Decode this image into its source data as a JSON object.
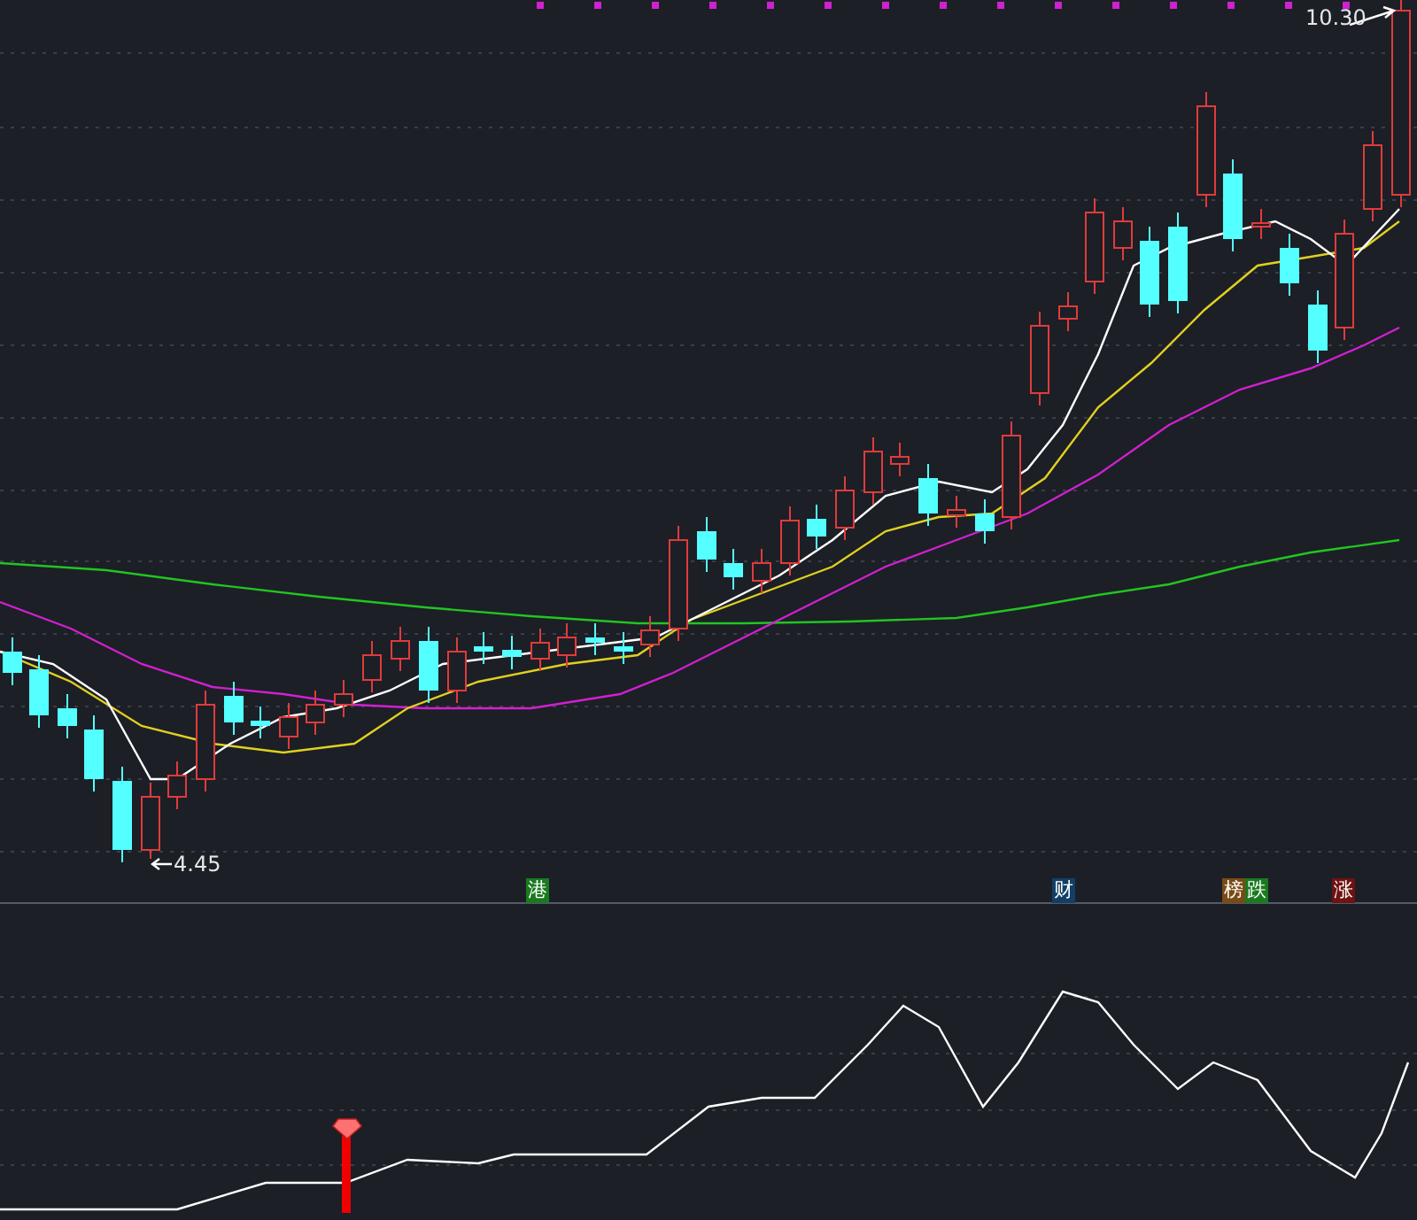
{
  "price_chart": {
    "high_label": "10.30",
    "low_label": "4.45",
    "event_tags": [
      {
        "label": "港",
        "color": "#1a7a1f"
      },
      {
        "label": "财",
        "color": "#123f66"
      },
      {
        "label": "榜",
        "color": "#7a4a15"
      },
      {
        "label": "跌",
        "color": "#1a7a1f"
      },
      {
        "label": "涨",
        "color": "#6e1212"
      }
    ]
  }
}
